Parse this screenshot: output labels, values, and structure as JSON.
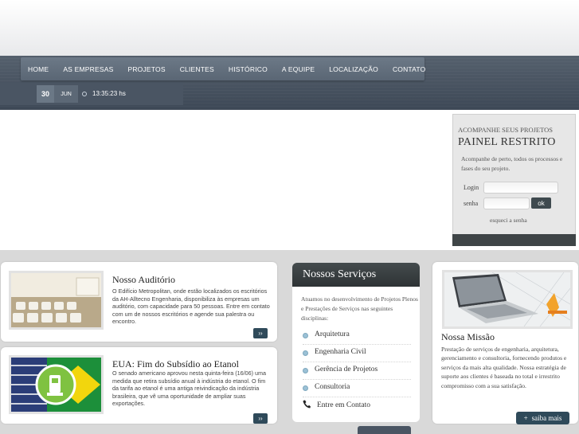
{
  "nav": {
    "items": [
      "HOME",
      "AS EMPRESAS",
      "PROJETOS",
      "CLIENTES",
      "HISTÓRICO",
      "A EQUIPE",
      "LOCALIZAÇÃO",
      "CONTATO"
    ]
  },
  "date": {
    "day": "30",
    "month": "JUN",
    "time": "13:35:23 hs",
    "icon": "clock-icon"
  },
  "painel": {
    "kicker": "ACOMPANHE SEUS PROJETOS",
    "title": "PAINEL RESTRITO",
    "text": "Acompanhe de perto, todos os processos e fases do seu projeto.",
    "login_label": "Login",
    "senha_label": "senha",
    "ok_label": "ok",
    "forgot": "esqueci a senha"
  },
  "news": [
    {
      "title": "Nosso Auditório",
      "text": "O Edifício Metropolitan, onde estão localizados os escritórios da AH-Alltecno Engenharia, disponibiliza às empresas um auditório, com capacidade para 50 pessoas. Entre em contato com um de nossos escritórios e agende sua palestra ou encontro.",
      "more": "››"
    },
    {
      "title": "EUA: Fim do Subsídio ao Etanol",
      "text": "O senado americano aprovou nesta quinta-feira (16/06) uma medida que retira subsídio anual à indústria do etanol. O fim da tarifa ao etanol é uma antiga reivindicação da indústria brasileira, que vê uma oportunidade de ampliar suas exportações.",
      "more": "››"
    }
  ],
  "services": {
    "title": "Nossos Serviços",
    "intro": "Atuamos no desenvolvimento de Projetos Plenos e Prestações de Serviços nas seguintes disciplinas:",
    "items": [
      "Arquitetura",
      "Engenharia Civil",
      "Gerência de Projetos",
      "Consultoria"
    ],
    "contact": "Entre em Contato",
    "contact_icon": "phone-icon"
  },
  "mission": {
    "title": "Nossa Missão",
    "text": "Prestação de serviços de engenharia, arquitetura, gerenciamento e consultoria, fornecendo produtos e serviços da mais alta qualidade. Nossa estratégia de suporte aos clientes é baseada no total e irrestrito compromisso com a sua satisfação.",
    "more": "saiba mais"
  },
  "colors": {
    "header": "#4a5563",
    "nav": "#637080",
    "accent_button": "#2f4a5a",
    "service_dot": "#9bc1d6"
  }
}
